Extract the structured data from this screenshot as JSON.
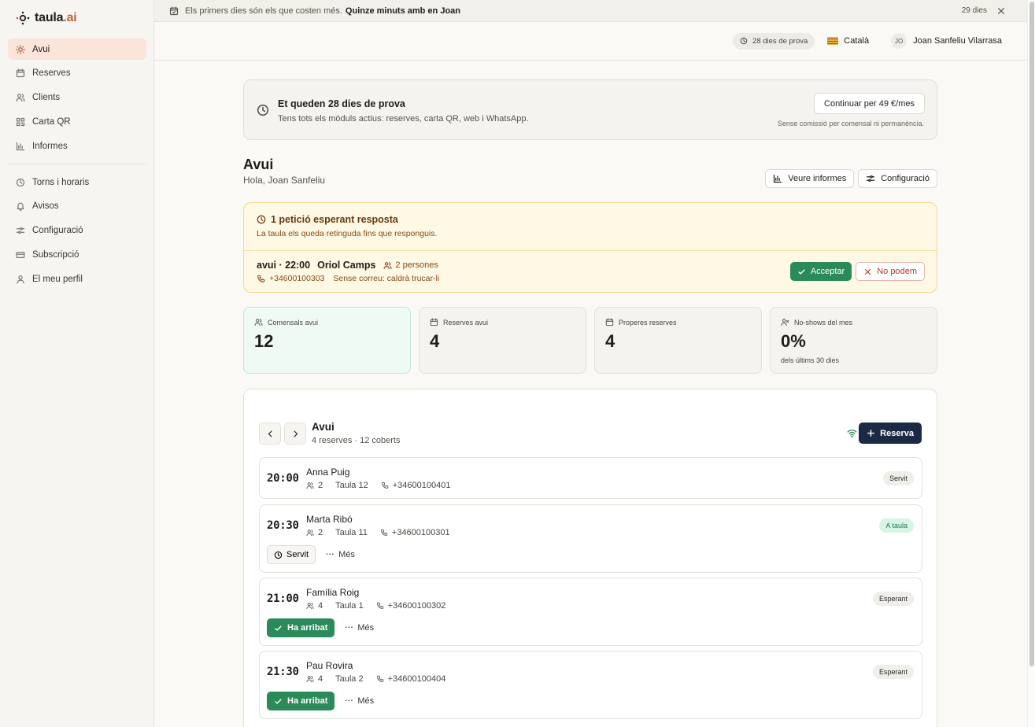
{
  "app": {
    "logo_text": "taula",
    "logo_suffix": ".ai"
  },
  "sidebar": {
    "items": [
      {
        "label": "Avui",
        "icon": "sun-icon",
        "active": true
      },
      {
        "label": "Reserves",
        "icon": "calendar-icon"
      },
      {
        "label": "Clients",
        "icon": "users-icon"
      },
      {
        "label": "Carta QR",
        "icon": "qr-icon"
      },
      {
        "label": "Informes",
        "icon": "bar-chart-icon"
      }
    ],
    "items2": [
      {
        "label": "Torns i horaris",
        "icon": "clock-icon"
      },
      {
        "label": "Avisos",
        "icon": "bell-icon"
      },
      {
        "label": "Configuració",
        "icon": "sliders-icon"
      },
      {
        "label": "Subscripció",
        "icon": "credit-card-icon"
      },
      {
        "label": "El meu perfil",
        "icon": "user-icon"
      }
    ]
  },
  "banner": {
    "text": "Els primers dies són els que costen més.",
    "link": "Quinze minuts amb en Joan",
    "days": "29 dies"
  },
  "header": {
    "trial_pill": "28 dies de prova",
    "language": "Català",
    "user_initials": "JO",
    "user_name": "Joan Sanfeliu Vilarrasa"
  },
  "trial": {
    "title": "Et queden 28 dies de prova",
    "text": "Tens tots els mòduls actius: reserves, carta QR, web i WhatsApp.",
    "button": "Continuar per 49 €/mes",
    "note": "Sense comissió per comensal ni permanència."
  },
  "page": {
    "title": "Avui",
    "subtitle": "Hola, Joan Sanfeliu",
    "btn_reports": "Veure informes",
    "btn_config": "Configuració"
  },
  "pending": {
    "title": "1 petició esperant resposta",
    "text": "La taula els queda retinguda fins que responguis.",
    "when": "avui · 22:00",
    "name": "Oriol Camps",
    "people": "2 persones",
    "phone": "+34600100303",
    "email_note": "Sense correu: caldrà trucar-li",
    "accept": "Acceptar",
    "reject": "No podem"
  },
  "stats": [
    {
      "label": "Comensals avui",
      "value": "12",
      "sub": "",
      "icon": "users-icon"
    },
    {
      "label": "Reserves avui",
      "value": "4",
      "sub": "",
      "icon": "calendar-icon"
    },
    {
      "label": "Properes reserves",
      "value": "4",
      "sub": "",
      "icon": "calendar-icon"
    },
    {
      "label": "No-shows del mes",
      "value": "0%",
      "sub": "dels últims 30 dies",
      "icon": "user-x-icon"
    }
  ],
  "reservations": {
    "title": "Avui",
    "summary": "4 reserves · 12 coberts",
    "new_button": "Reserva",
    "items": [
      {
        "time": "20:00",
        "name": "Anna Puig",
        "guests": "2",
        "table": "Taula 12",
        "phone": "+34600100401",
        "status": "Servit"
      },
      {
        "time": "20:30",
        "name": "Marta Ribó",
        "guests": "2",
        "table": "Taula 11",
        "phone": "+34600100301",
        "status": "A taula",
        "action": "Servit",
        "more": "Més"
      },
      {
        "time": "21:00",
        "name": "Família Roig",
        "guests": "4",
        "table": "Taula 1",
        "phone": "+34600100302",
        "status": "Esperant",
        "action": "Ha arribat",
        "more": "Més"
      },
      {
        "time": "21:30",
        "name": "Pau Rovira",
        "guests": "4",
        "table": "Taula 2",
        "phone": "+34600100404",
        "status": "Esperant",
        "action": "Ha arribat",
        "more": "Més"
      }
    ]
  }
}
